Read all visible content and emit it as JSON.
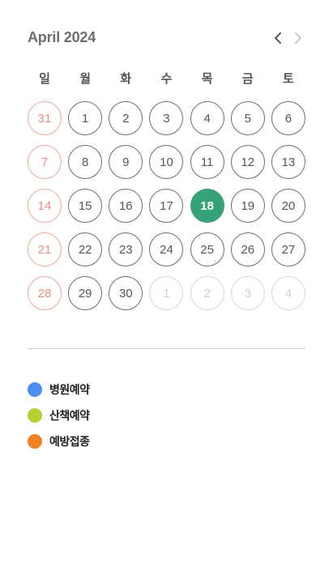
{
  "calendar": {
    "title": "April 2024",
    "prev_icon": "chevron-left-icon",
    "next_icon": "chevron-right-icon",
    "weekdays": [
      "일",
      "월",
      "화",
      "수",
      "목",
      "금",
      "토"
    ],
    "weeks": [
      [
        {
          "label": "31",
          "sunday": true
        },
        {
          "label": "1"
        },
        {
          "label": "2"
        },
        {
          "label": "3"
        },
        {
          "label": "4"
        },
        {
          "label": "5"
        },
        {
          "label": "6"
        }
      ],
      [
        {
          "label": "7",
          "sunday": true
        },
        {
          "label": "8"
        },
        {
          "label": "9"
        },
        {
          "label": "10"
        },
        {
          "label": "11"
        },
        {
          "label": "12"
        },
        {
          "label": "13"
        }
      ],
      [
        {
          "label": "14",
          "sunday": true
        },
        {
          "label": "15"
        },
        {
          "label": "16"
        },
        {
          "label": "17"
        },
        {
          "label": "18",
          "selected": true
        },
        {
          "label": "19"
        },
        {
          "label": "20"
        }
      ],
      [
        {
          "label": "21",
          "sunday": true
        },
        {
          "label": "22"
        },
        {
          "label": "23"
        },
        {
          "label": "24"
        },
        {
          "label": "25"
        },
        {
          "label": "26"
        },
        {
          "label": "27"
        }
      ],
      [
        {
          "label": "28",
          "sunday": true
        },
        {
          "label": "29"
        },
        {
          "label": "30"
        },
        {
          "label": "1",
          "outside": true
        },
        {
          "label": "2",
          "outside": true
        },
        {
          "label": "3",
          "outside": true
        },
        {
          "label": "4",
          "outside": true
        }
      ]
    ],
    "colors": {
      "selected": "#35a27a",
      "sunday": "#ef8d80",
      "outside": "#cfcfcf"
    }
  },
  "legend": [
    {
      "label": "병원예약",
      "color": "#4b8ef0"
    },
    {
      "label": "산책예약",
      "color": "#b9d033"
    },
    {
      "label": "예방접종",
      "color": "#f28324"
    }
  ]
}
